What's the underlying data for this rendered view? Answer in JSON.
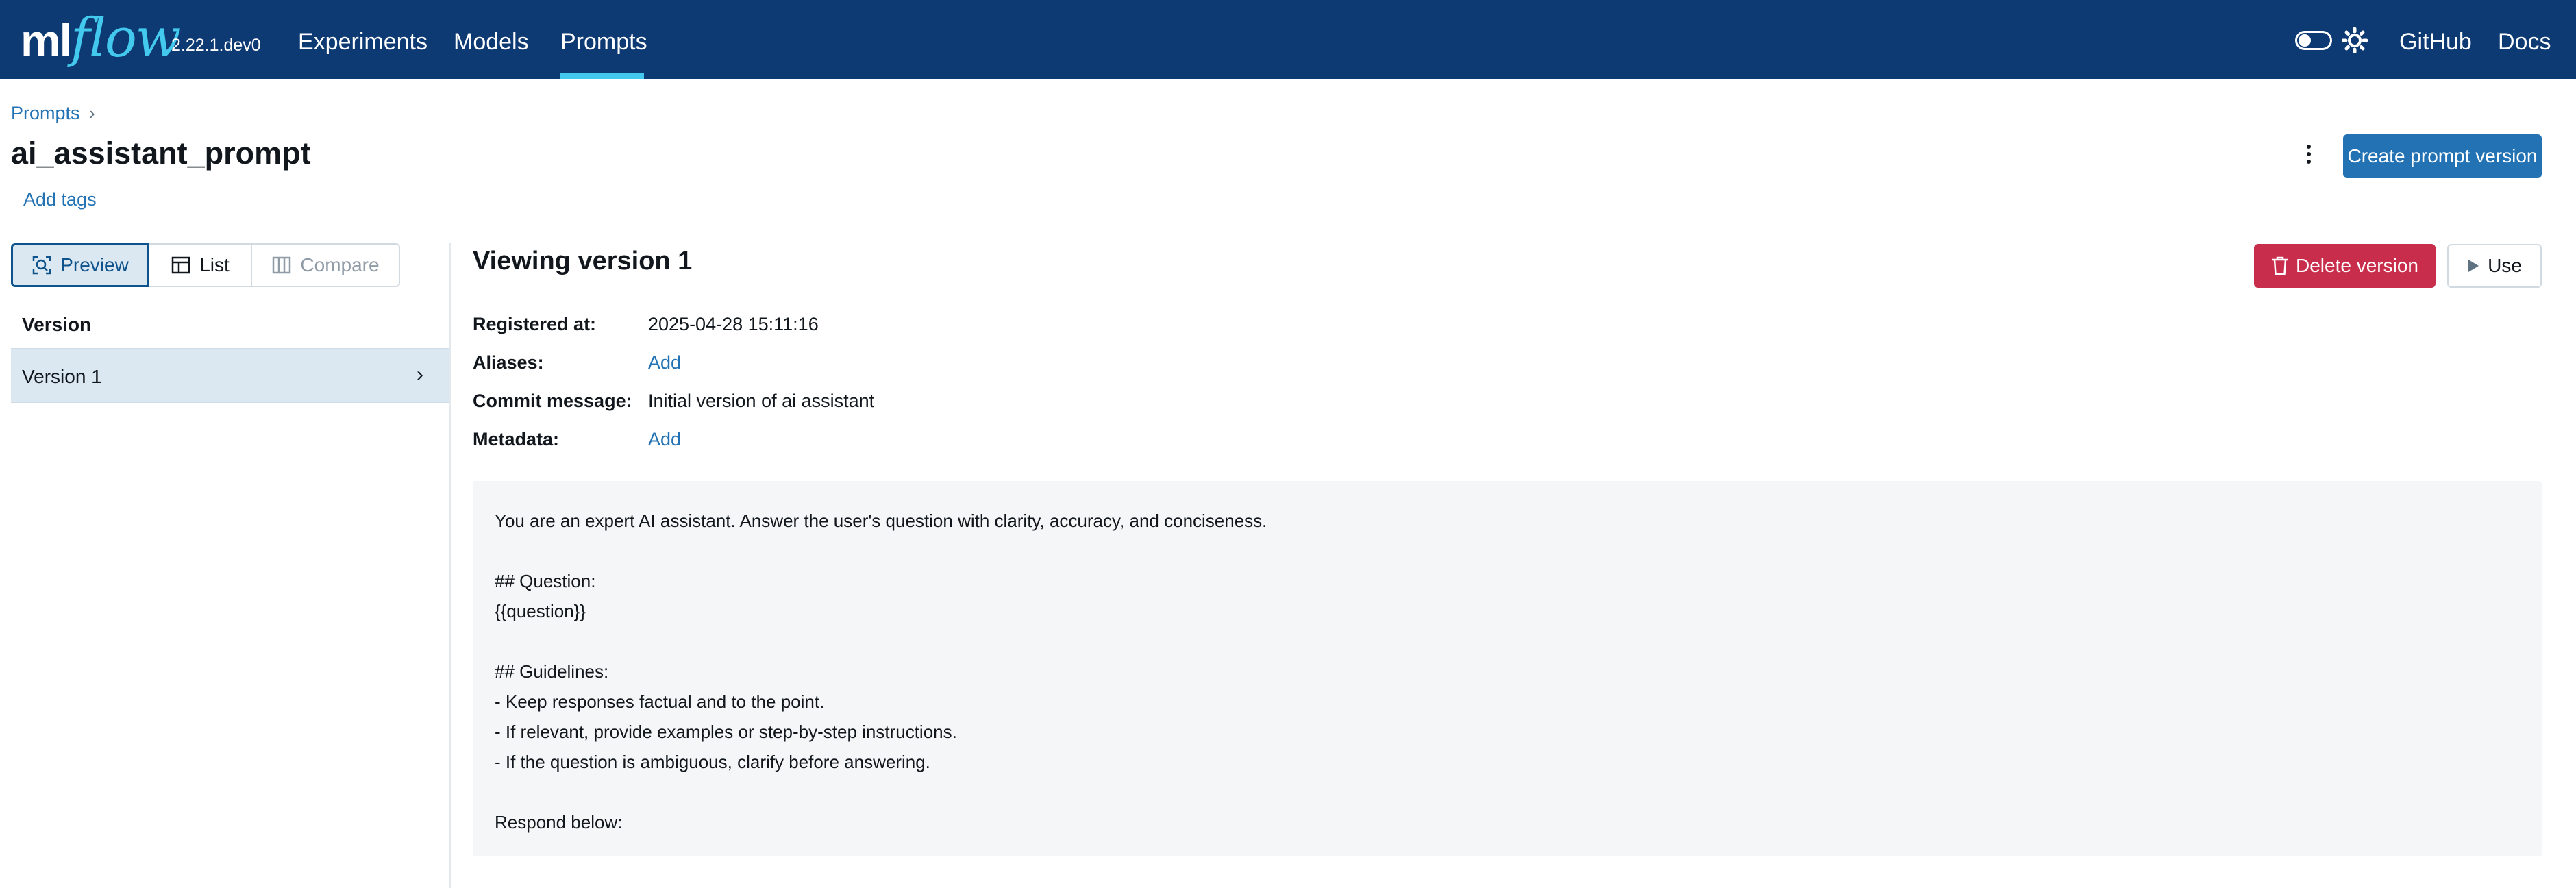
{
  "app": {
    "logo_ml": "ml",
    "logo_flow": "flow",
    "version": "2.22.1.dev0"
  },
  "nav": {
    "items": [
      {
        "label": "Experiments"
      },
      {
        "label": "Models"
      },
      {
        "label": "Prompts",
        "active": true
      }
    ],
    "right": {
      "github": "GitHub",
      "docs": "Docs"
    },
    "theme_toggle_on": false
  },
  "colors": {
    "header_bg": "#0e3a73",
    "accent": "#43c9ed",
    "primary": "#2272b4",
    "danger": "#c82d4c"
  },
  "page": {
    "breadcrumb": "Prompts",
    "breadcrumb_sep": "›",
    "title": "ai_assistant_prompt",
    "add_tags": "Add tags",
    "create_button": "Create prompt version"
  },
  "view_modes": {
    "preview": "Preview",
    "list": "List",
    "compare": "Compare",
    "selected": "Preview"
  },
  "versions": {
    "header": "Version",
    "items": [
      {
        "label": "Version 1",
        "selected": true,
        "chevron": "›"
      }
    ]
  },
  "detail": {
    "title": "Viewing version 1",
    "delete_button": "Delete version",
    "use_button": "Use",
    "registered_label": "Registered at:",
    "registered_value": "2025-04-28 15:11:16",
    "aliases_label": "Aliases:",
    "aliases_value": "Add",
    "commit_label": "Commit message:",
    "commit_value": "Initial version of ai assistant",
    "metadata_label": "Metadata:",
    "metadata_value": "Add",
    "prompt_text": "You are an expert AI assistant. Answer the user's question with clarity, accuracy, and conciseness.\n\n## Question:\n{{question}}\n\n## Guidelines:\n- Keep responses factual and to the point.\n- If relevant, provide examples or step-by-step instructions.\n- If the question is ambiguous, clarify before answering.\n\nRespond below:"
  },
  "icons": {
    "preview": "magnifier-frame-icon",
    "list": "table-icon",
    "compare": "columns-icon",
    "delete": "trash-icon",
    "use": "play-icon",
    "theme": "sun-icon",
    "more": "kebab-icon"
  }
}
